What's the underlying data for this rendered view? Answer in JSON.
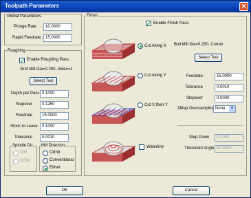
{
  "window": {
    "title": "Toolpath Parameters",
    "close_glyph": "✕"
  },
  "global": {
    "heading": "Global Parameters",
    "plunge_label": "Plunge Rate",
    "plunge_value": "10.0000",
    "rapid_label": "Rapid Feedrate",
    "rapid_value": "15.0000"
  },
  "roughing": {
    "heading": "Roughing",
    "enable_label": "Enable Roughing Pass",
    "tool_text": "End Mill Dia=0.250, Index=1",
    "select_tool": "Select Tool",
    "depth_label": "Depth per Pass",
    "depth_value": "0.1000",
    "stepover_label": "Stepover",
    "stepover_value": "0.1250",
    "feedrate_label": "Feedrate",
    "feedrate_value": "15.0000",
    "stock_label": "Stock to Leave",
    "stock_value": "0.1000",
    "tolerance_label": "Tolerance",
    "tolerance_value": "0.0010",
    "spindle_heading": "Spindle Dir",
    "cw": "CW",
    "ccw": "CCW",
    "milldir_heading": "Mill Direction",
    "climb": "Climb",
    "conventional": "Conventional",
    "either": "Either"
  },
  "finish": {
    "heading": "Finish",
    "enable_label": "Enable Finish Pass",
    "cut_x": "Cut Along X",
    "cut_y": "Cut Along Y",
    "cut_xy": "Cut X then Y",
    "tool_text": "Bull Mill Dia=0.250, Corner",
    "select_tool": "Select Tool",
    "feedrate_label": "Feedrate",
    "feedrate_value": "15.0000",
    "tolerance_label": "Tolerance",
    "tolerance_value": "0.0010",
    "stepover_label": "Stepover",
    "stepover_value": "0.0000",
    "zmap_label": "ZMap Oversampling",
    "zmap_value": "None",
    "waterline_label": "Waterline",
    "stepdown_label": "Step Down",
    "stepdown_value": "0.1000",
    "threshold_label": "Threshold Angle",
    "threshold_value": "60.0000"
  },
  "footer": {
    "ok": "OK",
    "cancel": "Cancel"
  }
}
